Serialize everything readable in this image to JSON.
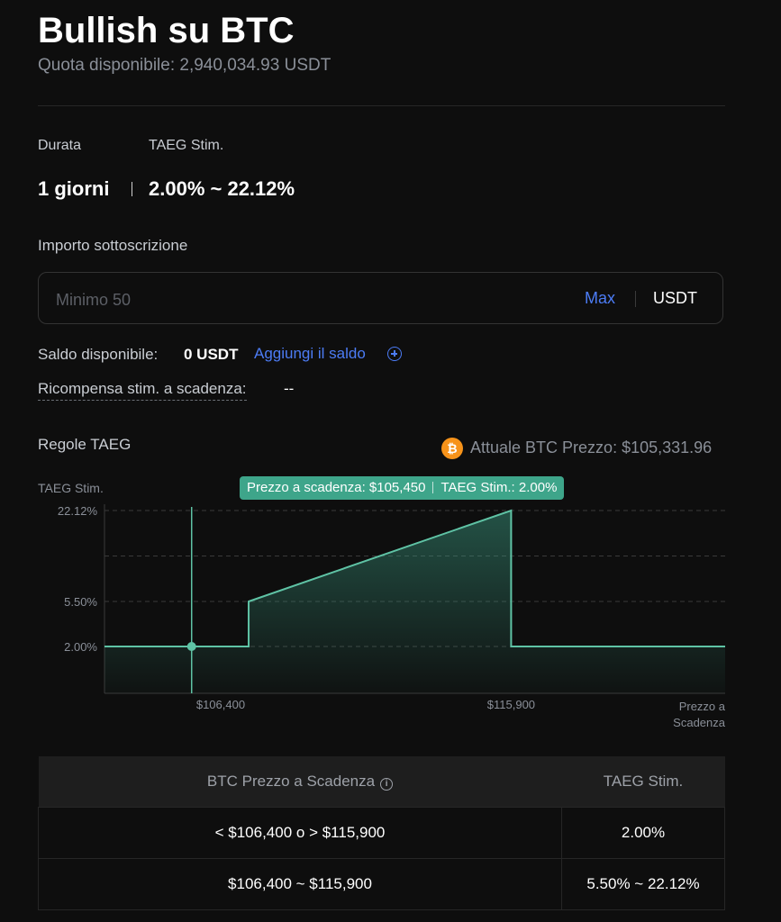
{
  "header": {
    "title": "Bullish su BTC",
    "quota": "Quota disponibile: 2,940,034.93 USDT"
  },
  "summary": {
    "duration_label": "Durata",
    "apr_label": "TAEG Stim.",
    "duration_value": "1 giorni",
    "apr_value": "2.00% ~ 22.12%"
  },
  "subscription": {
    "label": "Importo sottoscrizione",
    "input_value": "",
    "placeholder": "Minimo 50",
    "max_label": "Max",
    "currency": "USDT"
  },
  "balance": {
    "label": "Saldo disponibile:",
    "value": "0 USDT",
    "add_label": "Aggiungi il saldo"
  },
  "reward": {
    "label": "Ricompensa stim. a scadenza:",
    "value": "--"
  },
  "rules": {
    "label": "Regole TAEG",
    "current_price": "Attuale BTC Prezzo: $105,331.96",
    "btc_icon_glyph": "₿"
  },
  "tooltip": {
    "price": "Prezzo a scadenza: $105,450",
    "apr": "TAEG Stim.: 2.00%"
  },
  "chart_data": {
    "type": "area",
    "ylabel": "TAEG Stim.",
    "xlabel_line1": "Prezzo a",
    "xlabel_line2": "Scadenza",
    "y_ticks": [
      {
        "value": 2.0,
        "label": "2.00%"
      },
      {
        "value": 5.5,
        "label": "5.50%"
      },
      {
        "value": 22.12,
        "label": "22.12%"
      }
    ],
    "x_ticks": [
      {
        "value": 106400,
        "label": "$106,400"
      },
      {
        "value": 115900,
        "label": "$115,900"
      }
    ],
    "x_range": [
      102600,
      122900
    ],
    "points": [
      {
        "x": 102600,
        "y": 2.0
      },
      {
        "x": 107315,
        "y": 2.0
      },
      {
        "x": 107315,
        "y": 5.5
      },
      {
        "x": 115900,
        "y": 22.12
      },
      {
        "x": 115900,
        "y": 2.0
      },
      {
        "x": 122900,
        "y": 2.0
      }
    ],
    "marker": {
      "x": 105450,
      "y": 2.0
    },
    "line_color": "#5fc3a5",
    "grid": "dashed"
  },
  "table": {
    "headers": [
      "BTC Prezzo a Scadenza",
      "TAEG Stim."
    ],
    "info_icon_glyph": "i",
    "rows": [
      [
        "< $106,400 o > $115,900",
        "2.00%"
      ],
      [
        "$106,400 ~ $115,900",
        "5.50% ~ 22.12%"
      ]
    ]
  }
}
